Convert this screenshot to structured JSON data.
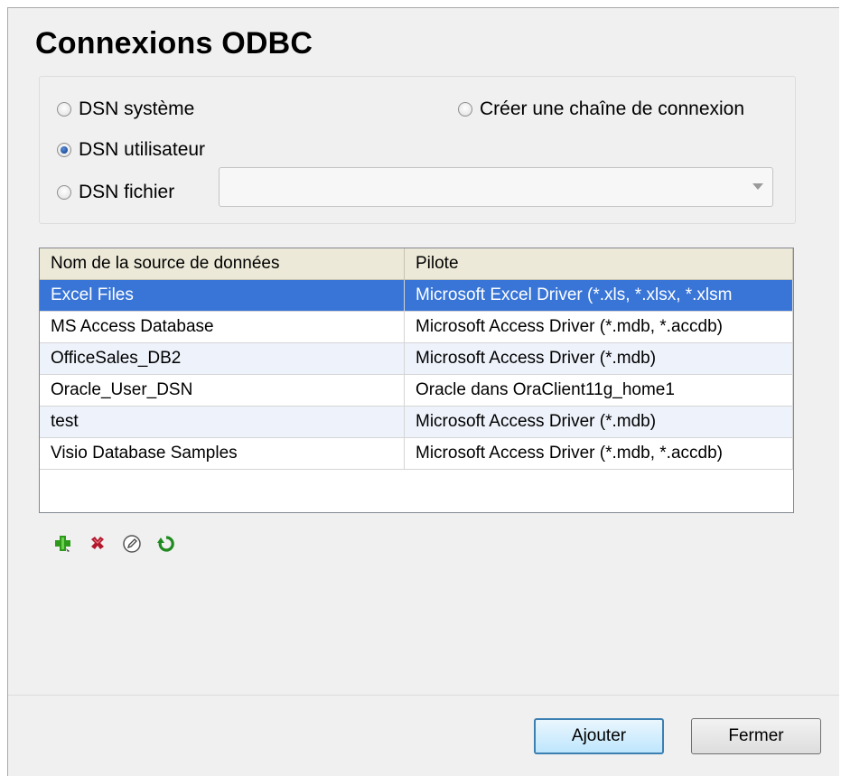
{
  "dialog": {
    "title": "Connexions ODBC"
  },
  "options": {
    "dsn_system": "DSN système",
    "dsn_user": "DSN utilisateur",
    "dsn_file": "DSN fichier",
    "connection_string": "Créer une chaîne de connexion",
    "selected": "dsn_user",
    "file_combo_value": ""
  },
  "table": {
    "columns": [
      "Nom de la source de données",
      "Pilote"
    ],
    "rows": [
      {
        "name": "Excel Files",
        "driver": "Microsoft Excel Driver (*.xls, *.xlsx, *.xlsm",
        "selected": true
      },
      {
        "name": "MS Access Database",
        "driver": "Microsoft Access Driver (*.mdb, *.accdb)"
      },
      {
        "name": "OfficeSales_DB2",
        "driver": "Microsoft Access Driver (*.mdb)"
      },
      {
        "name": "Oracle_User_DSN",
        "driver": "Oracle dans OraClient11g_home1"
      },
      {
        "name": "test",
        "driver": "Microsoft Access Driver (*.mdb)"
      },
      {
        "name": "Visio Database Samples",
        "driver": "Microsoft Access Driver (*.mdb, *.accdb)"
      }
    ]
  },
  "toolbar": {
    "icons": [
      "add-icon",
      "delete-icon",
      "edit-icon",
      "refresh-icon"
    ]
  },
  "buttons": {
    "add": "Ajouter",
    "close": "Fermer"
  },
  "colors": {
    "selection": "#3875d7",
    "add_green": "#2e9a1c",
    "delete_red": "#b3162b"
  }
}
